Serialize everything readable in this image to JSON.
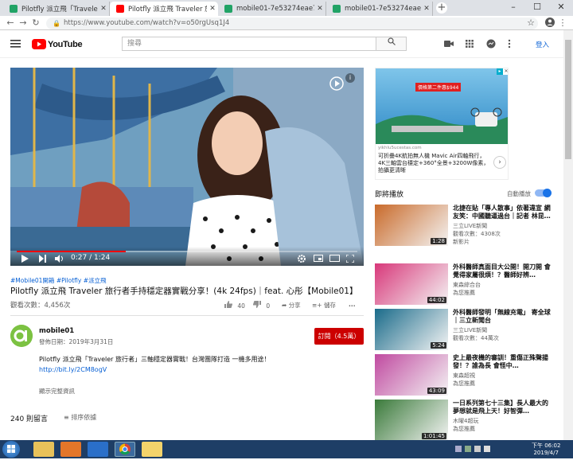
{
  "tabs": [
    {
      "label": "Pilotfly 派立飛「Traveler 旅行者」",
      "icon_color": "#21a366"
    },
    {
      "label": "Pilotfly 派立飛 Traveler 旅行者手",
      "icon_color": "#ff0000"
    },
    {
      "label": "mobile01-7e53274eae7bf181…",
      "icon_color": "#21a366"
    },
    {
      "label": "mobile01-7e53274eae7bf181…",
      "icon_color": "#21a366"
    }
  ],
  "address": {
    "url": "https://www.youtube.com/watch?v=o50rgUsq1J4"
  },
  "header": {
    "logo_text": "YouTube",
    "search_placeholder": "搜尋",
    "login_label": "登入"
  },
  "video": {
    "current_time": "0:27",
    "duration": "1:24",
    "time_display": "0:27 / 1:24",
    "progress_fraction": 0.32,
    "hashtags": "#Mobile01開箱 #Pilotfly #派立飛",
    "title": "Pilotfly 派立飛 Traveler 旅行者手持穩定器實戰分享！(4k 24fps)｜feat. 心彤【Mobile01】",
    "views": "觀看次數：4,456次",
    "likes": "40",
    "dislikes": "0",
    "share_label": "分享",
    "save_label": "儲存",
    "more_label": "..."
  },
  "channel": {
    "name": "mobile01",
    "published": "發佈日期：2019年3月31日",
    "subscribe_label": "訂閱（4.5萬）",
    "description": "Pilotfly 派立飛「Traveler 旅行者」三軸穩定器實戰！台灣團隊打造 一機多用途！",
    "link": "http://bit.ly/2CM8ogV",
    "show_more": "顯示完整資訊"
  },
  "comments": {
    "count_label": "240 則留言",
    "sort_label": "排序依據"
  },
  "ad": {
    "headline": "可折疊4K航拍無人機 Mavic Air四軸飛行，4K三軸雲台穩定+360°全景+3200W像素，拍攝更清晰",
    "domain": "yikhlu5ucestas.com",
    "banner": "價格第二件惠$944"
  },
  "upnext": {
    "heading": "即將播放",
    "autoplay_label": "自動播放",
    "autoplay_on": true,
    "videos": [
      {
        "title": "北捷在貼「專人散事」依著違宣 網友笑：中國聽逼過台｜記者 林昆…",
        "channel": "三立LIVE新聞",
        "views": "觀看次數：4308次",
        "extra": "新影片",
        "duration": "1:28",
        "thumb_color": "#c96a2a"
      },
      {
        "title": "外科醫師真面目大公開！開刀開 會覺得家屬很煩！？醫師好辨…",
        "channel": "東森綜合台",
        "views": "",
        "extra": "為您推薦",
        "duration": "44:02",
        "thumb_color": "#d8387a"
      },
      {
        "title": "外科醫師發明「無線充電」 寄全球｜三立新聞台",
        "channel": "三立LIVE新聞",
        "views": "觀看次數：44萬次",
        "extra": "",
        "duration": "5:24",
        "thumb_color": "#1a6b8a"
      },
      {
        "title": "史上最夜機的審訓！重傷正殊聲揚發！？誰為長 會怪中…",
        "channel": "東森超視",
        "views": "",
        "extra": "為您推薦",
        "duration": "43:09",
        "thumb_color": "#c04aa0"
      },
      {
        "title": "一日系列第七十三集】長人最大的夢想就是飛上天！好智彈…",
        "channel": "木曜4超玩",
        "views": "",
        "extra": "為您推薦",
        "duration": "1:01:45",
        "thumb_color": "#3a7a3a"
      }
    ]
  },
  "taskbar": {
    "time": "下午 06:02",
    "date": "2019/4/7"
  },
  "colors": {
    "accent_red": "#ff0000",
    "subscribe": "#cc0000",
    "link_blue": "#065fd4"
  }
}
